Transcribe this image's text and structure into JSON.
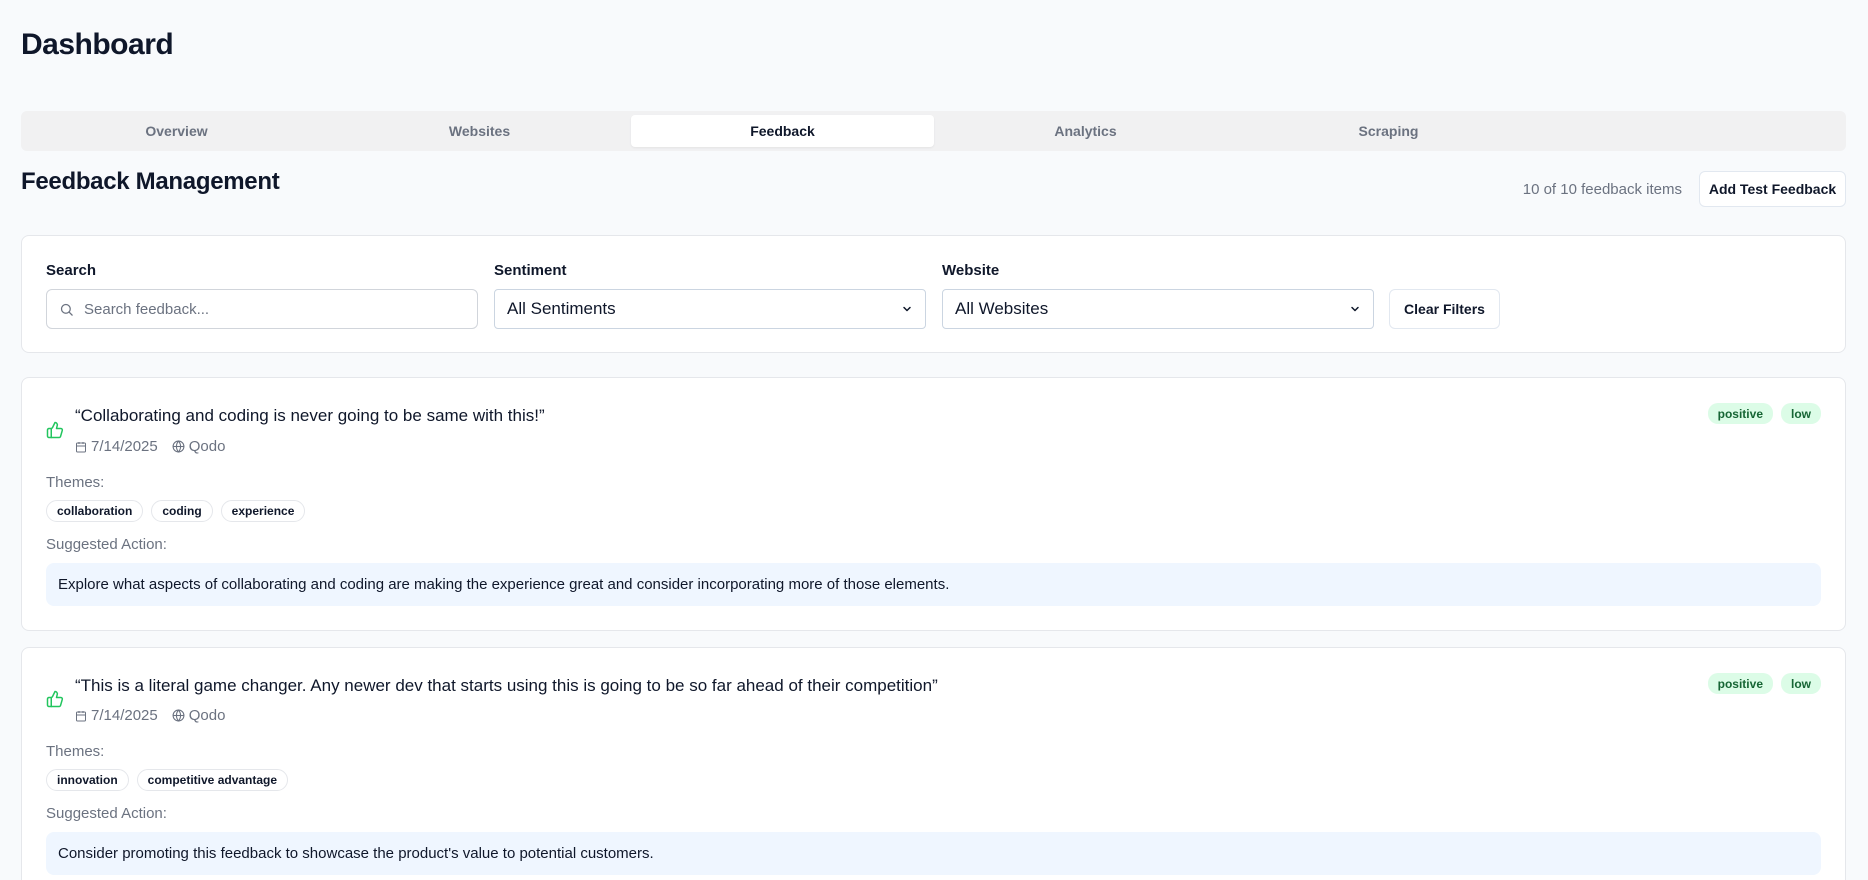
{
  "page_title": "Dashboard",
  "tabs": [
    {
      "label": "Overview",
      "active": false
    },
    {
      "label": "Websites",
      "active": false
    },
    {
      "label": "Feedback",
      "active": true
    },
    {
      "label": "Analytics",
      "active": false
    },
    {
      "label": "Scraping",
      "active": false
    }
  ],
  "section": {
    "title": "Feedback Management",
    "count_text": "10 of 10 feedback items",
    "add_button": "Add Test Feedback"
  },
  "filters": {
    "search_label": "Search",
    "search_placeholder": "Search feedback...",
    "sentiment_label": "Sentiment",
    "sentiment_value": "All Sentiments",
    "website_label": "Website",
    "website_value": "All Websites",
    "clear_button": "Clear Filters"
  },
  "labels": {
    "themes": "Themes:",
    "suggested_action": "Suggested Action:"
  },
  "feedback": [
    {
      "quote": "“Collaborating and coding is never going to be same with this!”",
      "date": "7/14/2025",
      "website": "Qodo",
      "sentiment": "positive",
      "priority": "low",
      "themes": [
        "collaboration",
        "coding",
        "experience"
      ],
      "action": "Explore what aspects of collaborating and coding are making the experience great and consider incorporating more of those elements."
    },
    {
      "quote": "“This is a literal game changer. Any newer dev that starts using this is going to be so far ahead of their competition”",
      "date": "7/14/2025",
      "website": "Qodo",
      "sentiment": "positive",
      "priority": "low",
      "themes": [
        "innovation",
        "competitive advantage"
      ],
      "action": "Consider promoting this feedback to showcase the product's value to potential customers."
    }
  ],
  "colors": {
    "accent_green": "#22c55e",
    "badge_bg": "#dcfce7",
    "action_bg": "#eff6ff"
  }
}
